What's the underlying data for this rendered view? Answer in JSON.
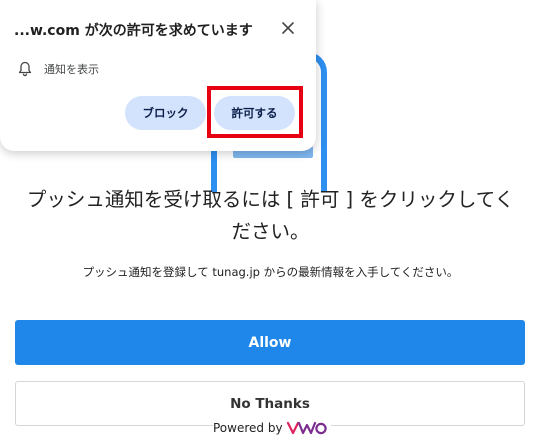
{
  "popup": {
    "title": "...w.com が次の許可を求めています",
    "notify_label": "通知を表示",
    "block_label": "ブロック",
    "allow_label": "許可する",
    "close_icon": "close-icon",
    "bell_icon": "bell-icon",
    "highlight_color": "#e60012"
  },
  "main": {
    "heading_line1": "プッシュ通知を受け取るには [ 許可 ] をクリックしてく",
    "heading_line2": "ださい。",
    "subtext": "プッシュ通知を登録して tunag.jp からの最新情報を入手してください。",
    "allow_label": "Allow",
    "no_thanks_label": "No Thanks",
    "powered_by": "Powered by",
    "brand_logo_text": "VWO"
  },
  "colors": {
    "allow_button": "#1f86ea",
    "popup_button": "#d3e3fd",
    "brand": "#7b2e8e"
  }
}
